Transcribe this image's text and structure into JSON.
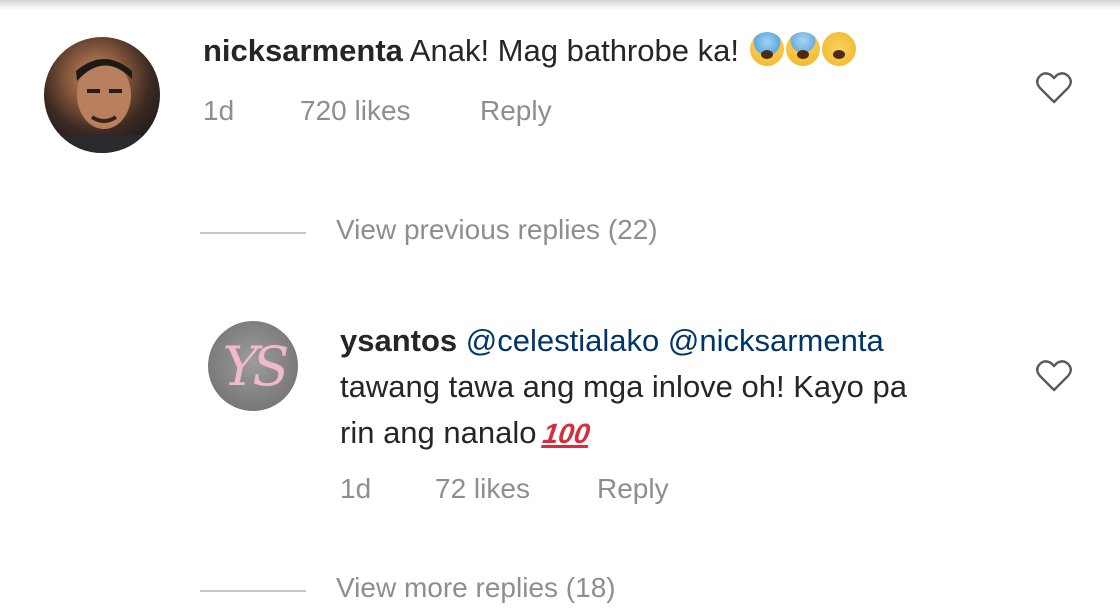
{
  "comments": [
    {
      "username": "nicksarmenta",
      "text": "Anak! Mag bathrobe ka!",
      "emojis": [
        "face-screaming-in-fear",
        "anxious-face-with-sweat",
        "weary-face"
      ],
      "time": "1d",
      "likes": "720 likes",
      "reply_label": "Reply",
      "avatar_icon": "profile-photo-avatar"
    },
    {
      "username": "ysantos",
      "mentions": [
        "@celestialako",
        "@nicksarmenta"
      ],
      "text_line2": "tawang tawa ang mga inlove oh! Kayo pa",
      "text_line3": "rin ang nanalo",
      "emoji": "hundred-points",
      "emoji_text": "100",
      "time": "1d",
      "likes": "72 likes",
      "reply_label": "Reply",
      "avatar_monogram": "YS"
    }
  ],
  "view_previous_replies": "View previous replies (22)",
  "view_more_replies": "View more replies (18)",
  "colors": {
    "text": "#262626",
    "muted": "#8e8e8e",
    "mention": "#003569",
    "rule": "#c7c7c7"
  }
}
